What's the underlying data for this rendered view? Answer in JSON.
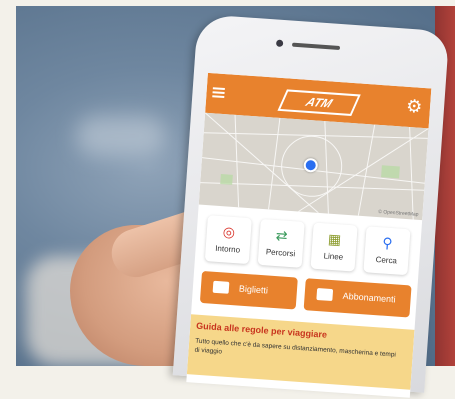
{
  "app": {
    "logo_text": "ATM"
  },
  "tiles": [
    {
      "label": "Intorno",
      "icon": "target-icon"
    },
    {
      "label": "Percorsi",
      "icon": "route-icon"
    },
    {
      "label": "Linee",
      "icon": "map-lines-icon"
    },
    {
      "label": "Cerca",
      "icon": "search-icon"
    }
  ],
  "buttons": {
    "tickets": "Biglietti",
    "subscriptions": "Abbonamenti"
  },
  "banner": {
    "title": "Guida alle regole per viaggiare",
    "body": "Tutto quello che c'è da sapere su distanziamento, mascherina e tempi di viaggio"
  },
  "colors": {
    "accent": "#e8822d",
    "banner_bg": "#f6d78a",
    "banner_title": "#c8351e",
    "location_pin": "#2a6ef0"
  }
}
